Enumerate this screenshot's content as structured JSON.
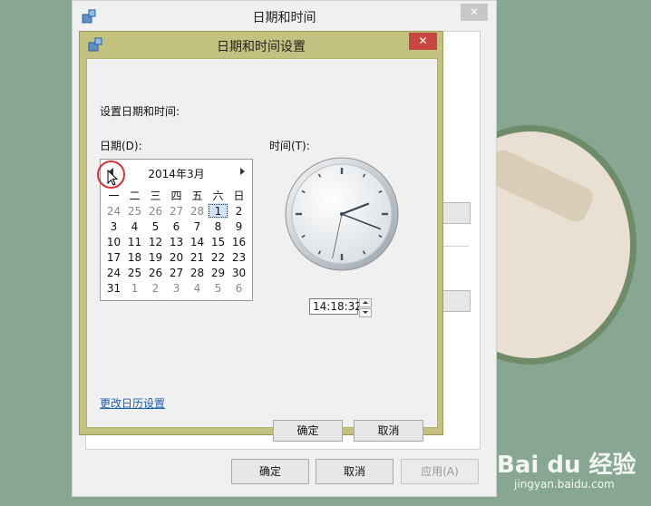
{
  "outer_dialog": {
    "title": "日期和时间",
    "close_label": "✕",
    "ok_label": "确定",
    "cancel_label": "取消",
    "apply_label": "应用(A)"
  },
  "inner_dialog": {
    "title": "日期和时间设置",
    "close_label": "✕",
    "heading": "设置日期和时间:",
    "date_label": "日期(D):",
    "time_label": "时间(T):",
    "month_title": "2014年3月",
    "weekdays": [
      "一",
      "二",
      "三",
      "四",
      "五",
      "六",
      "日"
    ],
    "weeks": [
      [
        {
          "d": "24",
          "o": true
        },
        {
          "d": "25",
          "o": true
        },
        {
          "d": "26",
          "o": true
        },
        {
          "d": "27",
          "o": true
        },
        {
          "d": "28",
          "o": true
        },
        {
          "d": "1",
          "sel": true
        },
        {
          "d": "2"
        }
      ],
      [
        {
          "d": "3"
        },
        {
          "d": "4"
        },
        {
          "d": "5"
        },
        {
          "d": "6"
        },
        {
          "d": "7"
        },
        {
          "d": "8"
        },
        {
          "d": "9"
        }
      ],
      [
        {
          "d": "10"
        },
        {
          "d": "11"
        },
        {
          "d": "12"
        },
        {
          "d": "13"
        },
        {
          "d": "14"
        },
        {
          "d": "15"
        },
        {
          "d": "16"
        }
      ],
      [
        {
          "d": "17"
        },
        {
          "d": "18"
        },
        {
          "d": "19"
        },
        {
          "d": "20"
        },
        {
          "d": "21"
        },
        {
          "d": "22"
        },
        {
          "d": "23"
        }
      ],
      [
        {
          "d": "24"
        },
        {
          "d": "25"
        },
        {
          "d": "26"
        },
        {
          "d": "27"
        },
        {
          "d": "28"
        },
        {
          "d": "29"
        },
        {
          "d": "30"
        }
      ],
      [
        {
          "d": "31"
        },
        {
          "d": "1",
          "o": true
        },
        {
          "d": "2",
          "o": true
        },
        {
          "d": "3",
          "o": true
        },
        {
          "d": "4",
          "o": true
        },
        {
          "d": "5",
          "o": true
        },
        {
          "d": "6",
          "o": true
        }
      ]
    ],
    "time_value": "14:18:32",
    "clock": {
      "hour": 14,
      "minute": 18,
      "second": 32
    },
    "change_calendar_link": "更改日历设置",
    "ok_label": "确定",
    "cancel_label": "取消"
  },
  "watermark": {
    "brand": "Bai du 经验",
    "url": "jingyan.baidu.com"
  },
  "colors": {
    "selection": "#cfe4f7",
    "close_red": "#c94743",
    "link": "#1a5fb4",
    "highlight_circle": "#d8323a"
  }
}
